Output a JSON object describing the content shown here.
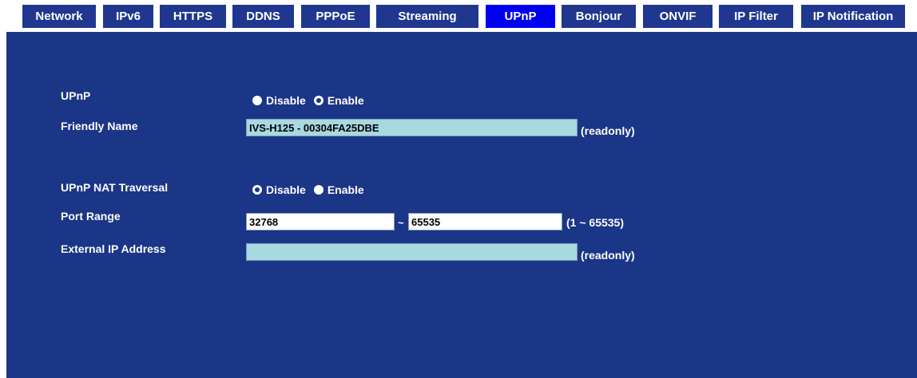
{
  "tabs": [
    {
      "label": "Network",
      "active": false
    },
    {
      "label": "IPv6",
      "active": false
    },
    {
      "label": "HTTPS",
      "active": false
    },
    {
      "label": "DDNS",
      "active": false
    },
    {
      "label": "PPPoE",
      "active": false
    },
    {
      "label": "Streaming",
      "active": false
    },
    {
      "label": "UPnP",
      "active": true
    },
    {
      "label": "Bonjour",
      "active": false
    },
    {
      "label": "ONVIF",
      "active": false
    },
    {
      "label": "IP Filter",
      "active": false
    },
    {
      "label": "IP Notification",
      "active": false
    }
  ],
  "colors": {
    "panel_background": "#1b3587",
    "tab_background": "#20378f",
    "active_tab": "#0000f0",
    "readonly_field": "#a8d8e0"
  },
  "upnp": {
    "label": "UPnP",
    "disable_label": "Disable",
    "enable_label": "Enable",
    "selected": "Enable"
  },
  "friendly_name": {
    "label": "Friendly Name",
    "value": "IVS-H125 - 00304FA25DBE",
    "hint": "(readonly)"
  },
  "nat_traversal": {
    "label": "UPnP NAT Traversal",
    "disable_label": "Disable",
    "enable_label": "Enable",
    "selected": "Disable"
  },
  "port_range": {
    "label": "Port Range",
    "start": "32768",
    "separator": "~",
    "end": "65535",
    "hint": "(1 ~ 65535)"
  },
  "external_ip": {
    "label": "External IP Address",
    "value": "",
    "hint": "(readonly)"
  }
}
